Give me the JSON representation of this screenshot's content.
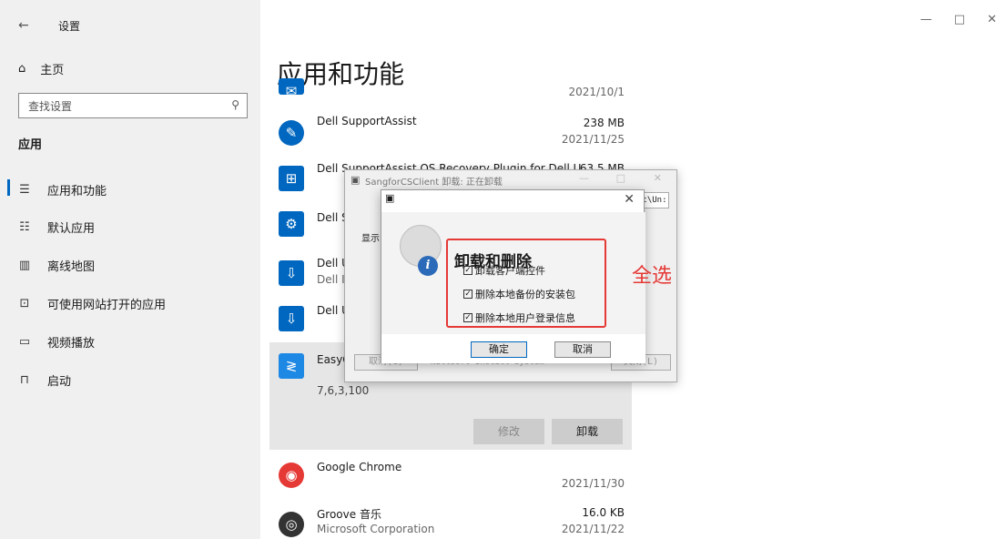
{
  "window": {
    "back_glyph": "←",
    "title": "设置",
    "controls": [
      "—",
      "□",
      "✕"
    ]
  },
  "sidebar": {
    "home": {
      "icon": "home-icon",
      "label": "主页"
    },
    "search": {
      "placeholder": "查找设置"
    },
    "section": "应用",
    "items": [
      {
        "icon": "apps-features-icon",
        "label": "应用和功能",
        "selected": true
      },
      {
        "icon": "default-apps-icon",
        "label": "默认应用"
      },
      {
        "icon": "offline-maps-icon",
        "label": "离线地图"
      },
      {
        "icon": "website-apps-icon",
        "label": "可使用网站打开的应用"
      },
      {
        "icon": "video-playback-icon",
        "label": "视频播放"
      },
      {
        "icon": "startup-icon",
        "label": "启动"
      }
    ]
  },
  "main": {
    "title": "应用和功能",
    "apps": [
      {
        "name": "",
        "sub": "",
        "size": "",
        "date": "2021/10/1"
      },
      {
        "name": "Dell SupportAssist",
        "sub": "",
        "size": "238 MB",
        "date": "2021/11/25"
      },
      {
        "name": "Dell SupportAssist OS Recovery Plugin for Dell U...",
        "sub": "",
        "size": "63.5 MB",
        "date": ""
      },
      {
        "name": "Dell S",
        "sub": "",
        "size": "",
        "date": ""
      },
      {
        "name": "Dell U",
        "sub": "Dell In",
        "size": "",
        "date": ""
      },
      {
        "name": "Dell U",
        "sub": "",
        "size": "",
        "date": ""
      },
      {
        "name": "EasyC",
        "sub": "",
        "size": "",
        "date": ""
      },
      {
        "name": "Google Chrome",
        "sub": "",
        "size": "",
        "date": "2021/11/30"
      },
      {
        "name": "Groove 音乐",
        "sub": "Microsoft Corporation",
        "size": "16.0 KB",
        "date": "2021/11/22"
      }
    ],
    "selected_version": "7,6,3,100",
    "modify_label": "修改",
    "uninstall_label": "卸载"
  },
  "installer": {
    "title": "SangforCSClient 卸载: 正在卸载",
    "path_fragment": "nt\\Un:",
    "show_label": "显示",
    "cancel_label": "取消(C)",
    "brand": "Nullsoft Install System",
    "close_label": "关闭(L)"
  },
  "dialog": {
    "heading": "卸载和删除",
    "options": [
      {
        "label": "卸载客户端控件",
        "checked": true
      },
      {
        "label": "删除本地备份的安装包",
        "checked": true
      },
      {
        "label": "删除本地用户登录信息",
        "checked": true
      }
    ],
    "ok_label": "确定",
    "cancel_label": "取消"
  },
  "annotation": {
    "text": "全选",
    "color": "#e53935"
  }
}
